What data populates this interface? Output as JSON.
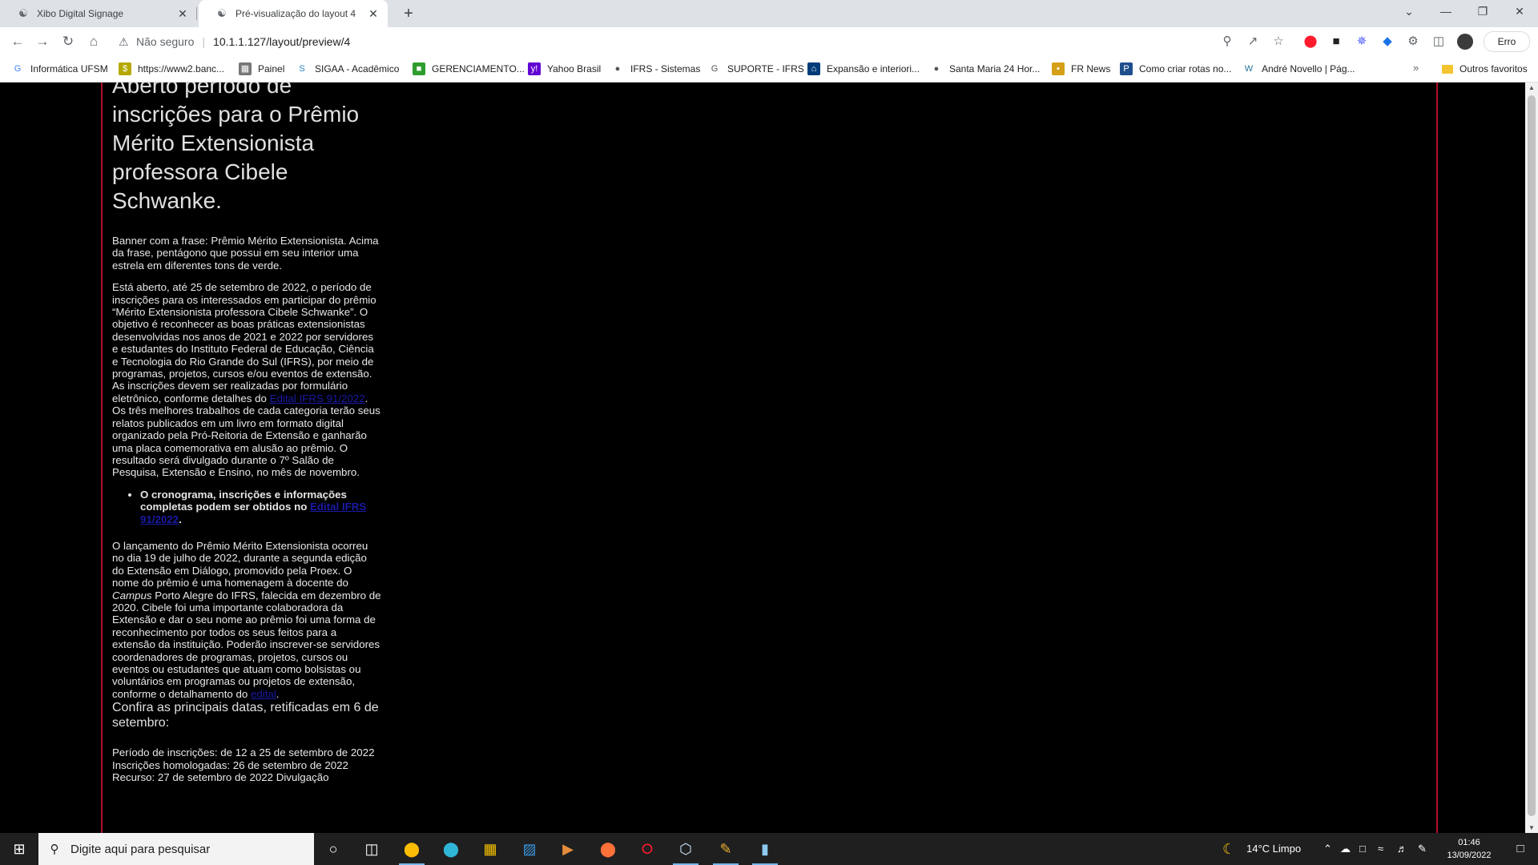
{
  "browser": {
    "tabs": [
      {
        "title": "Xibo Digital Signage",
        "icon": "xibo-icon"
      },
      {
        "title": "Pré-visualização do layout 4",
        "icon": "xibo-icon"
      }
    ],
    "address": {
      "security": "Não seguro",
      "url": "10.1.1.127/layout/preview/4"
    },
    "error_button": "Erro",
    "bookmarks": [
      {
        "label": "Informática UFSM",
        "icon": "google-icon",
        "color": "#4285f4"
      },
      {
        "label": "https://www2.banc...",
        "icon": "bank-icon",
        "color": "#b5a800"
      },
      {
        "label": "Painel",
        "icon": "panel-icon",
        "color": "#777777"
      },
      {
        "label": "SIGAA - Acadêmico",
        "icon": "sigaa-icon",
        "color": "#2e86c1"
      },
      {
        "label": "GERENCIAMENTO...",
        "icon": "ifrs-icon",
        "color": "#2e9d2e"
      },
      {
        "label": "Yahoo Brasil",
        "icon": "yahoo-icon",
        "color": "#6001d2"
      },
      {
        "label": "IFRS - Sistemas",
        "icon": "globe-icon",
        "color": "#555555"
      },
      {
        "label": "SUPORTE - IFRS",
        "icon": "support-icon",
        "color": "#555555"
      },
      {
        "label": "Expansão e interiori...",
        "icon": "ufsm-icon",
        "color": "#003b7a"
      },
      {
        "label": "Santa Maria 24 Hor...",
        "icon": "globe-icon",
        "color": "#555555"
      },
      {
        "label": "FR News",
        "icon": "lock-icon",
        "color": "#d4a017"
      },
      {
        "label": "Como criar rotas no...",
        "icon": "pti-icon",
        "color": "#1f4e8c"
      },
      {
        "label": "André Novello | Pág...",
        "icon": "wordpress-icon",
        "color": "#21759b"
      }
    ],
    "other_bookmarks": "Outros favoritos"
  },
  "article": {
    "title": "Aberto período de inscrições para o Prêmio Mérito Extensionista professora Cibele Schwanke.",
    "image_alt": "Banner com a frase: Prêmio Mérito Extensionista. Acima da frase, pentágono que possui em seu interior uma estrela em diferentes tons de verde.",
    "p1_before": "Está aberto, até 25 de setembro de 2022, o período de inscrições para os interessados em participar do prêmio “Mérito Extensionista professora Cibele Schwanke”. O objetivo é reconhecer as boas práticas extensionistas desenvolvidas nos anos de 2021 e 2022 por servidores e estudantes do Instituto Federal de Educação, Ciência e Tecnologia do Rio Grande do Sul (IFRS), por meio de programas, projetos, cursos e/ou eventos de extensão. As inscrições devem ser realizadas por formulário eletrônico, conforme detalhes do ",
    "p1_link": "Edital IFRS 91/2022",
    "p1_after": ". Os três melhores trabalhos de cada categoria terão seus relatos publicados em um livro em formato digital organizado pela Pró-Reitoria de Extensão e ganharão uma placa comemorativa em alusão ao prêmio. O resultado será divulgado durante o 7º Salão de Pesquisa, Extensão e Ensino, no mês de novembro.",
    "bullet_text": "O cronograma, inscrições e informações completas podem ser obtidos no ",
    "bullet_link": "Edital IFRS 91/2022",
    "bullet_end": ".",
    "p2_a": "O lançamento do Prêmio Mérito Extensionista ocorreu no dia 19 de julho de 2022, durante a segunda edição do Extensão em Diálogo, promovido pela Proex. O nome do prêmio é uma homenagem à docente do ",
    "p2_em": "Campus",
    "p2_b": " Porto Alegre do IFRS, falecida em dezembro de 2020. Cibele foi uma importante colaboradora da Extensão e dar o seu nome ao prêmio foi uma forma de reconhecimento por todos os seus feitos para a extensão da instituição. Poderão inscrever-se servidores coordenadores de programas, projetos, cursos ou eventos ou estudantes que atuam como bolsistas ou voluntários em programas ou projetos de extensão, conforme o detalhamento do ",
    "p2_link": "edital",
    "p2_end": ".",
    "subheading": "Confira as principais datas, retificadas em 6 de setembro:",
    "dates": "Período de inscrições: de 12 a 25 de setembro de 2022 Inscrições homologadas: 26 de setembro de 2022 Recurso: 27 de setembro de 2022 Divulgação"
  },
  "taskbar": {
    "search_placeholder": "Digite aqui para pesquisar",
    "weather": "14°C  Limpo",
    "time": "01:46",
    "date": "13/09/2022"
  }
}
